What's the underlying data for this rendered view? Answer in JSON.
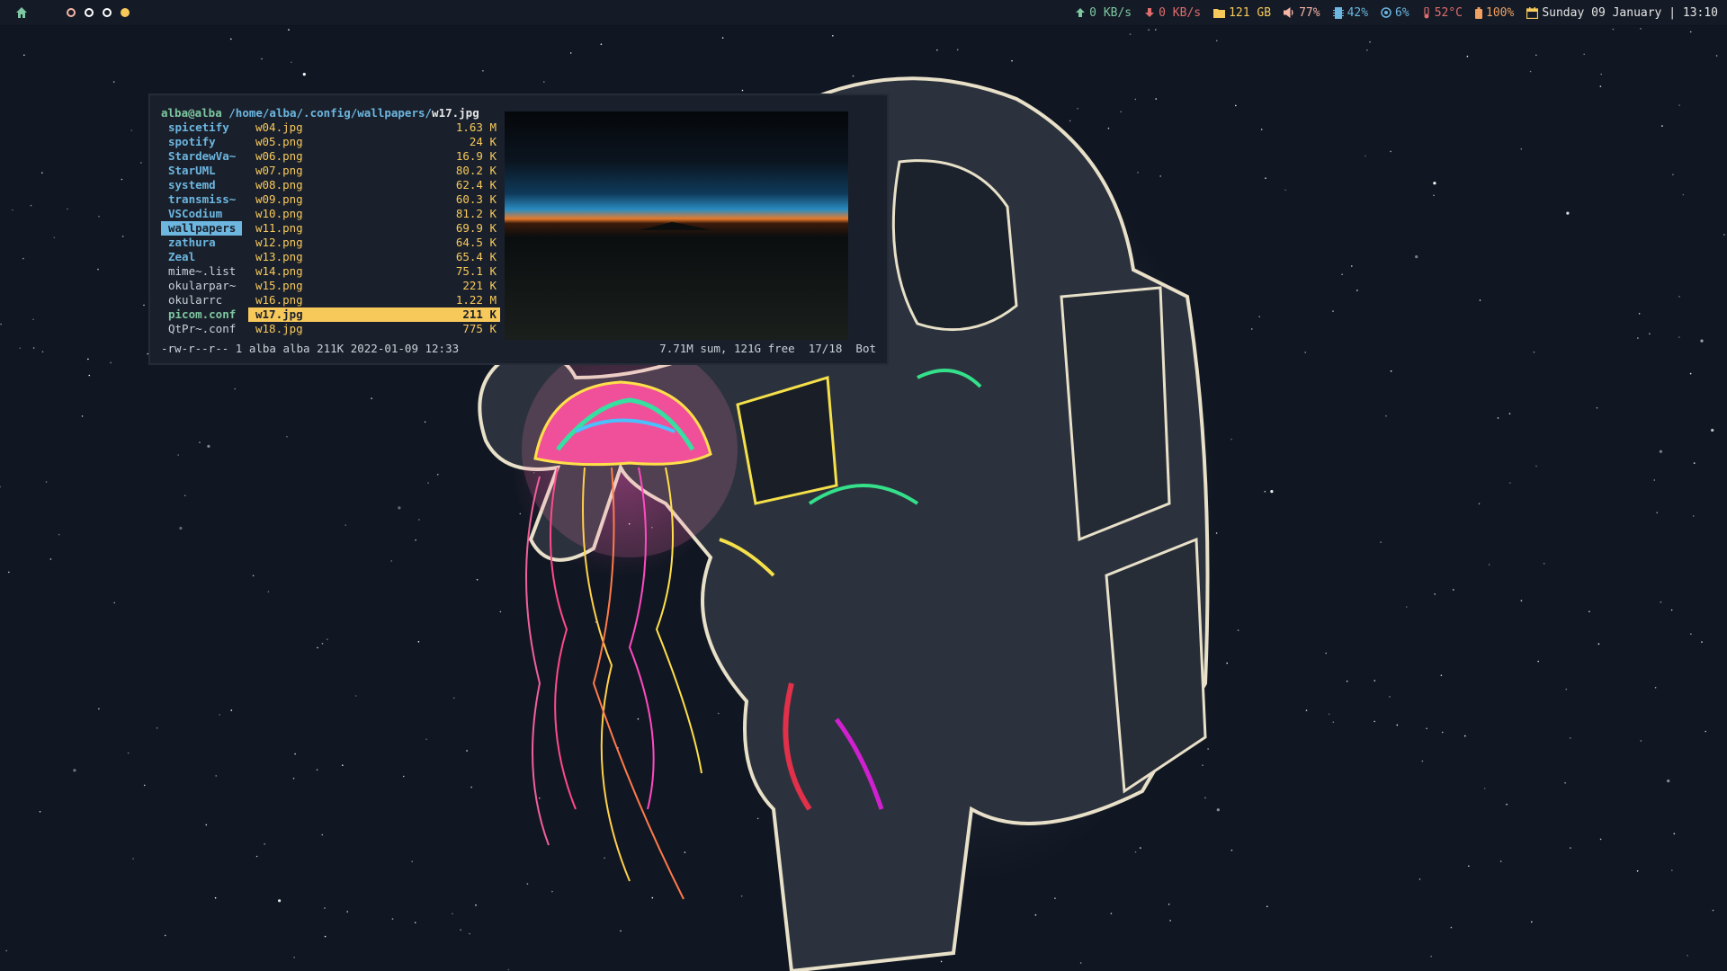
{
  "topbar": {
    "workspaces": [
      {
        "state": "active"
      },
      {
        "state": "empty"
      },
      {
        "state": "empty"
      },
      {
        "state": "occupied"
      }
    ],
    "modules": {
      "upload": "0 KB/s",
      "download": "0 KB/s",
      "disk": "121 GB",
      "volume": "77%",
      "memory": "42%",
      "cpu": "6%",
      "temperature": "52°C",
      "battery": "100%",
      "datetime": "Sunday 09 January | 13:10"
    },
    "icons": {
      "home": "home-icon",
      "upload": "arrow-up-icon",
      "download": "arrow-down-icon",
      "disk": "folder-icon",
      "volume": "speaker-icon",
      "memory": "memory-icon",
      "cpu": "cpu-icon",
      "temperature": "thermometer-icon",
      "battery": "battery-icon",
      "calendar": "calendar-icon"
    },
    "colors": {
      "upload": "#7ec7a0",
      "download": "#e06c6c",
      "disk": "#f7c95b",
      "volume": "#f7b6a6",
      "memory": "#6cb6e0",
      "cpu": "#6cb6e0",
      "temperature": "#e06c6c",
      "battery": "#f0a060",
      "calendar": "#f7c95b"
    }
  },
  "terminal": {
    "path": {
      "user": "alba@alba",
      "dir": "/home/alba/.config/wallpapers/",
      "file": "w17.jpg"
    },
    "dirs": [
      {
        "name": "spicetify",
        "kind": "dir"
      },
      {
        "name": "spotify",
        "kind": "dir"
      },
      {
        "name": "StardewVa~",
        "kind": "dir"
      },
      {
        "name": "StarUML",
        "kind": "dir"
      },
      {
        "name": "systemd",
        "kind": "dir"
      },
      {
        "name": "transmiss~",
        "kind": "dir"
      },
      {
        "name": "VSCodium",
        "kind": "dir"
      },
      {
        "name": "wallpapers",
        "kind": "dir",
        "selected": true
      },
      {
        "name": "zathura",
        "kind": "dir"
      },
      {
        "name": "Zeal",
        "kind": "dir"
      },
      {
        "name": "mime~.list",
        "kind": "plain"
      },
      {
        "name": "okularpar~",
        "kind": "plain"
      },
      {
        "name": "okularrc",
        "kind": "plain"
      },
      {
        "name": "picom.conf",
        "kind": "conf"
      },
      {
        "name": "QtPr~.conf",
        "kind": "plain"
      }
    ],
    "files": [
      {
        "name": "w04.jpg",
        "size": "1.63 M"
      },
      {
        "name": "w05.png",
        "size": "24 K"
      },
      {
        "name": "w06.png",
        "size": "16.9 K"
      },
      {
        "name": "w07.png",
        "size": "80.2 K"
      },
      {
        "name": "w08.png",
        "size": "62.4 K"
      },
      {
        "name": "w09.png",
        "size": "60.3 K"
      },
      {
        "name": "w10.png",
        "size": "81.2 K"
      },
      {
        "name": "w11.png",
        "size": "69.9 K"
      },
      {
        "name": "w12.png",
        "size": "64.5 K"
      },
      {
        "name": "w13.png",
        "size": "65.4 K"
      },
      {
        "name": "w14.png",
        "size": "75.1 K"
      },
      {
        "name": "w15.png",
        "size": "221 K"
      },
      {
        "name": "w16.png",
        "size": "1.22 M"
      },
      {
        "name": "w17.jpg",
        "size": "211 K",
        "selected": true
      },
      {
        "name": "w18.jpg",
        "size": "775 K"
      }
    ],
    "status": {
      "file_info": "-rw-r--r-- 1 alba alba 211K 2022-01-09 12:33",
      "summary": "7.71M sum, 121G free  17/18  Bot"
    }
  }
}
